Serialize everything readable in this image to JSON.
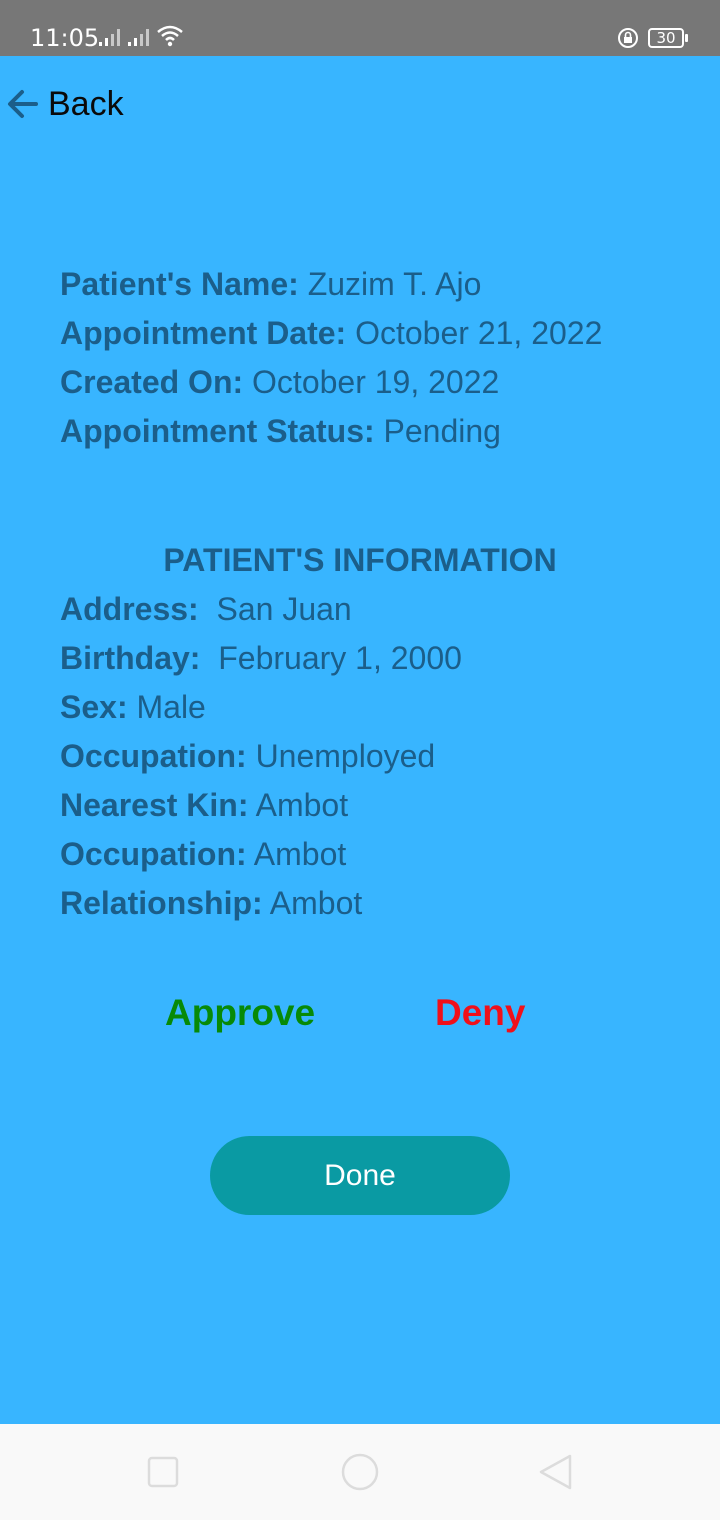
{
  "status_bar": {
    "time": "11:05",
    "battery": "30"
  },
  "header": {
    "back_label": "Back"
  },
  "appointment": {
    "patient_name_label": "Patient's Name:",
    "patient_name": " Zuzim T. Ajo",
    "date_label": "Appointment Date:",
    "date": " October 21, 2022",
    "created_label": "Created On:",
    "created": " October 19, 2022",
    "status_label": "Appointment Status:",
    "status": " Pending"
  },
  "patient_info": {
    "title": "PATIENT'S INFORMATION",
    "address_label": "Address:",
    "address": "  San Juan",
    "birthday_label": "Birthday:",
    "birthday": "  February 1, 2000",
    "sex_label": "Sex:",
    "sex": " Male",
    "occupation_label": "Occupation:",
    "occupation": " Unemployed",
    "kin_label": "Nearest Kin:",
    "kin": " Ambot",
    "kin_occupation_label": "Occupation:",
    "kin_occupation": " Ambot",
    "relationship_label": "Relationship:",
    "relationship": " Ambot"
  },
  "actions": {
    "approve": "Approve",
    "deny": "Deny",
    "done": "Done"
  },
  "colors": {
    "background": "#38b5ff",
    "text": "#1b5e8a",
    "approve": "#078a07",
    "deny": "#f0101a",
    "done_button": "#0a9aa3"
  }
}
